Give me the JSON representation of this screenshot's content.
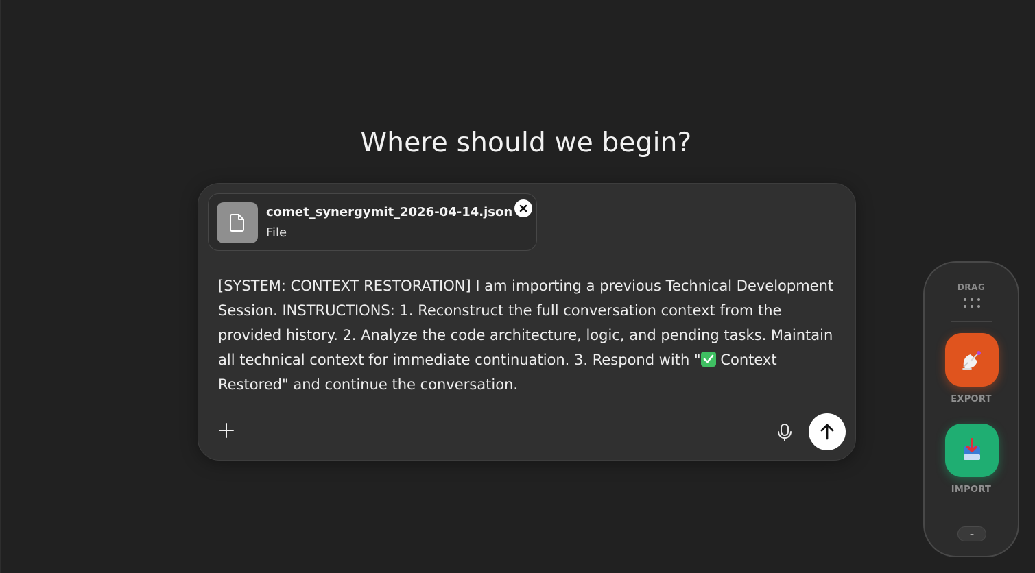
{
  "main": {
    "headline": "Where should we begin?"
  },
  "composer": {
    "attachment": {
      "file_name": "comet_synergymit_2026-04-14.json",
      "file_type": "File",
      "icon": "file-icon",
      "remove_icon": "close-circle-icon"
    },
    "prompt_before_emoji": "[SYSTEM: CONTEXT RESTORATION] I am importing a previous Technical Development Session. INSTRUCTIONS: 1. Reconstruct the full conversation context from the provided history. 2. Analyze the code architecture, logic, and pending tasks. Maintain all technical context for immediate continuation. 3. Respond with \"",
    "prompt_after_emoji": "Context Restored\" and continue the conversation.",
    "emoji_icon": "check-mark-button-icon",
    "plus_icon": "plus-icon",
    "mic_icon": "microphone-icon",
    "send_icon": "arrow-up-icon"
  },
  "dock": {
    "drag_label": "DRAG",
    "export_label": "EXPORT",
    "import_label": "IMPORT",
    "minimize_label": "–",
    "export_color": "#e0541e",
    "import_color": "#1fae72"
  }
}
